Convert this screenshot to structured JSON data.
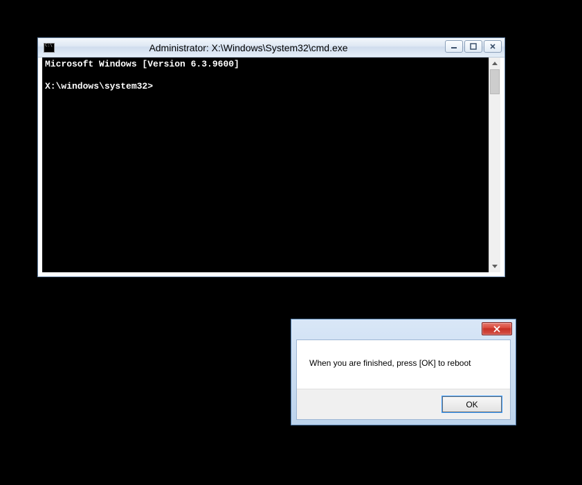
{
  "cmd": {
    "title": "Administrator: X:\\Windows\\System32\\cmd.exe",
    "line1": "Microsoft Windows [Version 6.3.9600]",
    "blank": "",
    "prompt": "X:\\windows\\system32>"
  },
  "dialog": {
    "message": "When you are finished, press [OK] to reboot",
    "ok_label": "OK"
  }
}
